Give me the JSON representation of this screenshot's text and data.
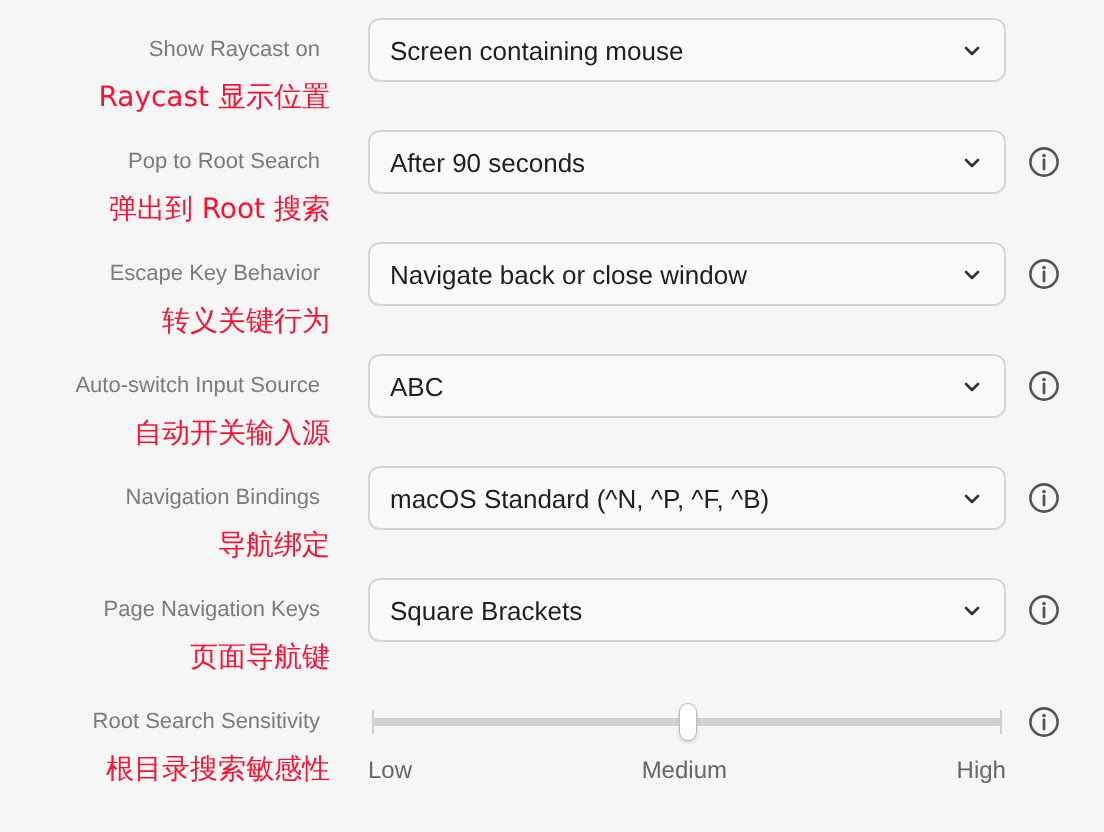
{
  "settings": [
    {
      "kind": "select",
      "label": "Show Raycast on",
      "value": "Screen containing mouse",
      "info": false,
      "note": "Raycast 显示位置"
    },
    {
      "kind": "select",
      "label": "Pop to Root Search",
      "value": "After 90 seconds",
      "info": true,
      "note": "弹出到 Root 搜索"
    },
    {
      "kind": "select",
      "label": "Escape Key Behavior",
      "value": "Navigate back or close window",
      "info": true,
      "note": "转义关键行为"
    },
    {
      "kind": "select",
      "label": "Auto-switch Input Source",
      "value": "ABC",
      "info": true,
      "note": "自动开关输入源"
    },
    {
      "kind": "select",
      "label": "Navigation Bindings",
      "value": "macOS Standard (^N, ^P, ^F, ^B)",
      "info": true,
      "note": "导航绑定"
    },
    {
      "kind": "select",
      "label": "Page Navigation Keys",
      "value": "Square Brackets",
      "info": true,
      "note": "页面导航键"
    },
    {
      "kind": "slider",
      "label": "Root Search Sensitivity",
      "level": 0.5,
      "ticks": [
        "Low",
        "Medium",
        "High"
      ],
      "info": true,
      "note": "根目录搜索敏感性"
    }
  ]
}
